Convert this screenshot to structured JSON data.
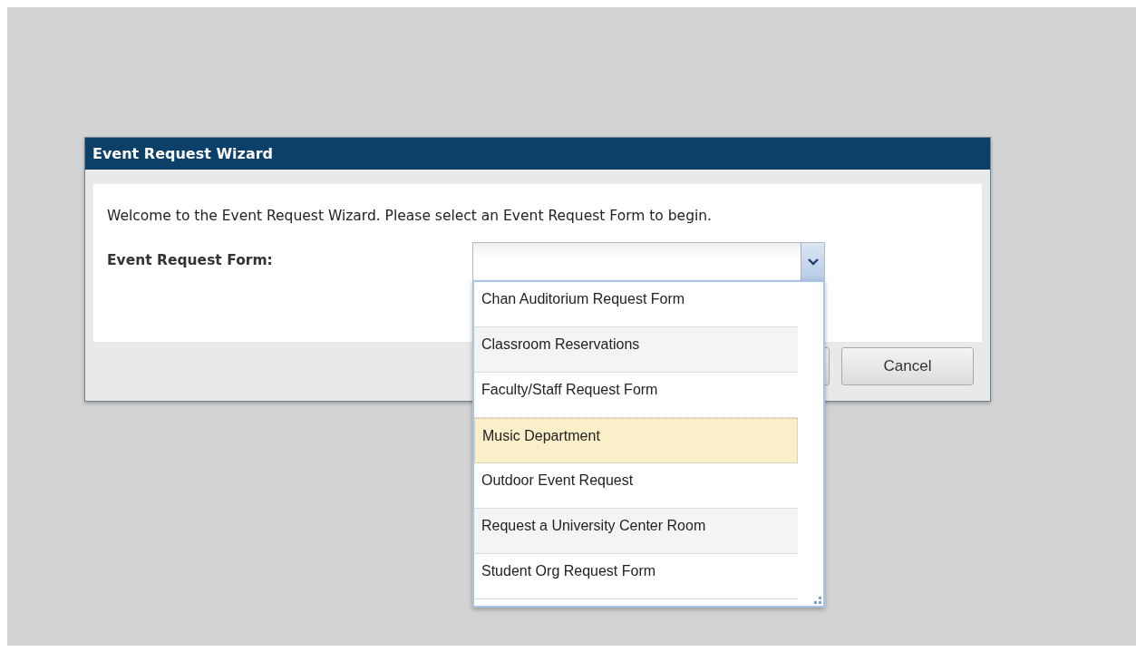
{
  "dialog": {
    "title": "Event Request Wizard",
    "intro": "Welcome to the Event Request Wizard. Please select an Event Request Form to begin.",
    "field_label": "Event Request Form:"
  },
  "dropdown": {
    "expanded": true,
    "options": [
      {
        "label": "Chan Auditorium Request Form",
        "selected": false
      },
      {
        "label": "Classroom Reservations",
        "selected": false
      },
      {
        "label": "Faculty/Staff Request Form",
        "selected": false
      },
      {
        "label": "Music Department",
        "selected": true
      },
      {
        "label": "Outdoor Event Request",
        "selected": false
      },
      {
        "label": "Request a University Center Room",
        "selected": false
      },
      {
        "label": "Student Org Request Form",
        "selected": false
      }
    ]
  },
  "buttons": [
    "Cancel"
  ]
}
